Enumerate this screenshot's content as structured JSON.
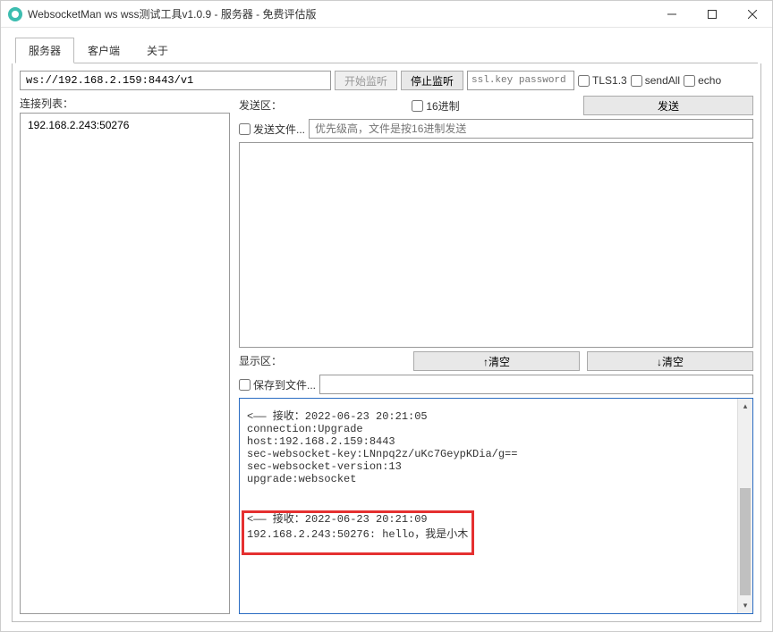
{
  "window": {
    "title": "WebsocketMan ws wss测试工具v1.0.9  - 服务器 - 免费评估版"
  },
  "tabs": {
    "items": [
      "服务器",
      "客户端",
      "关于"
    ],
    "active": 0
  },
  "url_bar": {
    "url": "ws://192.168.2.159:8443/v1",
    "start_listen": "开始监听",
    "stop_listen": "停止监听",
    "ssl_placeholder": "ssl.key password",
    "tls13": "TLS1.3",
    "sendall": "sendAll",
    "echo": "echo"
  },
  "left": {
    "label": "连接列表：",
    "items": [
      "192.168.2.243:50276"
    ]
  },
  "send": {
    "label": "发送区：",
    "hex_label": "16进制",
    "send_btn": "发送",
    "send_file_label": "发送文件...",
    "file_placeholder": "优先级高，文件是按16进制发送"
  },
  "display": {
    "label": "显示区：",
    "clear_up": "↑清空",
    "clear_down": "↓清空",
    "save_file_label": "保存到文件..."
  },
  "recv": {
    "text": "<—— 接收：2022-06-23 20:21:05\nconnection:Upgrade\nhost:192.168.2.159:8443\nsec-websocket-key:LNnpq2z/uKc7GeypKDia/g==\nsec-websocket-version:13\nupgrade:websocket\n\n\n<—— 接收：2022-06-23 20:21:09\n192.168.2.243:50276: hello，我是小木"
  }
}
